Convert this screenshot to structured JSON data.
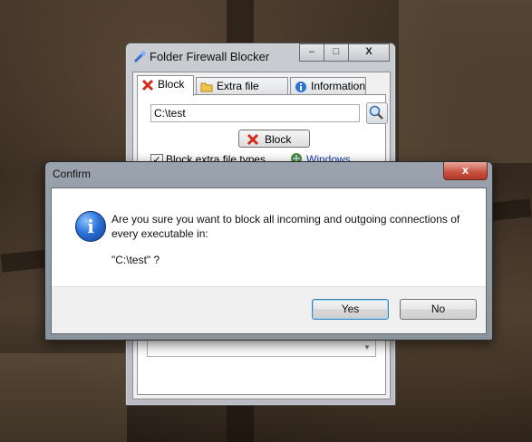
{
  "background_window": {
    "title": "Folder Firewall Blocker",
    "buttons": {
      "minimize": "–",
      "maximize": "□",
      "close": "X"
    },
    "tabs": [
      {
        "label": "Block",
        "icon": "red-x-icon",
        "active": true
      },
      {
        "label": "Extra file types",
        "icon": "folder-icon",
        "active": false
      },
      {
        "label": "Information",
        "icon": "info-icon",
        "active": false
      }
    ],
    "path_value": "C:\\test",
    "block_button_label": "Block",
    "checkbox_label": "Block extra file types",
    "checkbox_checked": true,
    "checkbox_mark": "✓",
    "firewall_link": "Windows Firewall"
  },
  "dialog": {
    "title": "Confirm",
    "close_label": "x",
    "icon": "info-icon",
    "icon_glyph": "i",
    "message": "Are you sure you want to block all incoming and outgoing connections of every executable in:",
    "path_line": "\"C:\\test\" ?",
    "yes_label": "Yes",
    "no_label": "No",
    "default_button": "Yes"
  },
  "colors": {
    "link": "#1a3fb0",
    "close_button": "#c9503f",
    "info_icon": "#2c74d8",
    "default_button_border": "#3c7fb1"
  }
}
